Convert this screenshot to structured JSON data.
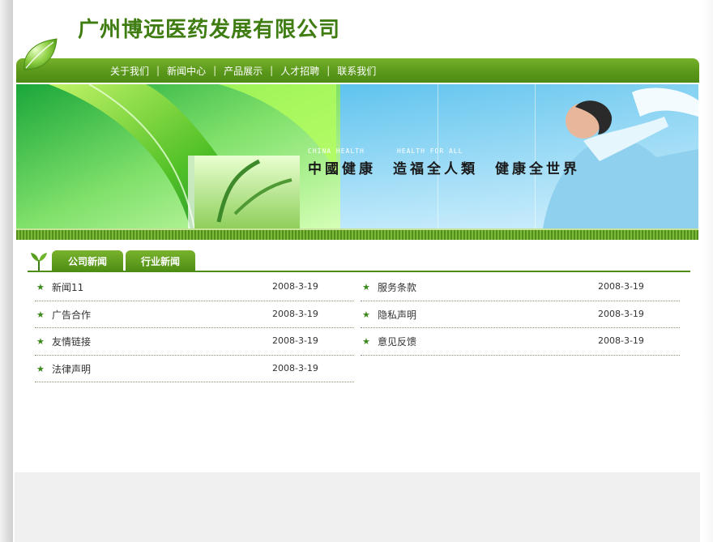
{
  "header": {
    "company_name": "广州博远医药发展有限公司"
  },
  "nav": {
    "items": [
      {
        "label": "关于我们"
      },
      {
        "label": "新闻中心"
      },
      {
        "label": "产品展示"
      },
      {
        "label": "人才招聘"
      },
      {
        "label": "联系我们"
      }
    ],
    "separator": "|"
  },
  "banner": {
    "en_left": "CHINA HEALTH",
    "en_right": "HEALTH FOR ALL",
    "slogan": "中國健康　造福全人類　健康全世界"
  },
  "tabs": [
    {
      "label": "公司新闻"
    },
    {
      "label": "行业新闻"
    }
  ],
  "news": {
    "left": [
      {
        "title": "新闻11",
        "date": "2008-3-19"
      },
      {
        "title": "广告合作",
        "date": "2008-3-19"
      },
      {
        "title": "友情链接",
        "date": "2008-3-19"
      },
      {
        "title": "法律声明",
        "date": "2008-3-19"
      }
    ],
    "right": [
      {
        "title": "服务条款",
        "date": "2008-3-19"
      },
      {
        "title": "隐私声明",
        "date": "2008-3-19"
      },
      {
        "title": "意见反馈",
        "date": "2008-3-19"
      }
    ]
  },
  "colors": {
    "brand_green": "#4e8d14",
    "star_green": "#3a8a1a",
    "title_green": "#3f7d12"
  },
  "icons": {
    "leaf": "leaf-icon",
    "sprout": "sprout-icon",
    "star": "star-icon"
  }
}
